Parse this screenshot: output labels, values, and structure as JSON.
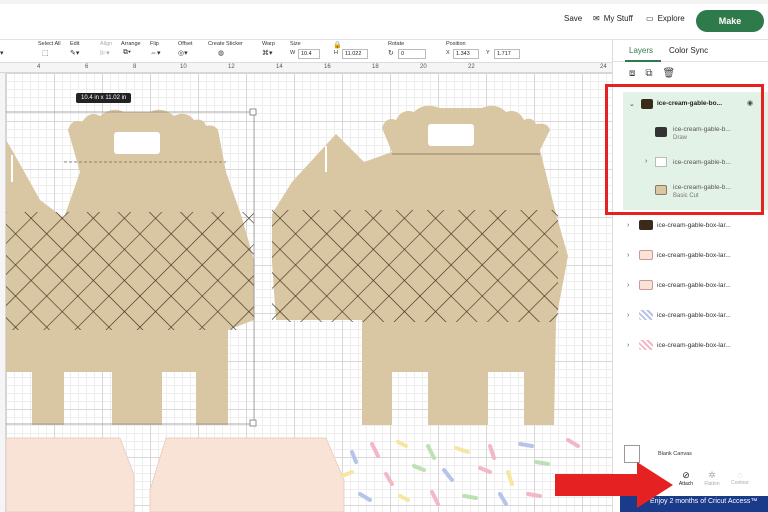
{
  "topbar": {
    "save": "Save",
    "my_stuff": "My Stuff",
    "explore": "Explore",
    "make": "Make"
  },
  "toolbar": {
    "select_all": "Select All",
    "edit": "Edit",
    "align": "Align",
    "arrange": "Arrange",
    "flip": "Flip",
    "offset": "Offset",
    "create_sticker": "Create Sticker",
    "warp": "Warp",
    "size": "Size",
    "w_label": "W",
    "w_value": "10.4",
    "h_label": "H",
    "h_value": "11.022",
    "rotate": "Rotate",
    "rotate_value": "0",
    "position": "Position",
    "x_label": "X",
    "x_value": "1.343",
    "y_label": "Y",
    "y_value": "1.717"
  },
  "ruler": {
    "marks": [
      "4",
      "6",
      "8",
      "10",
      "12",
      "14",
      "16",
      "18",
      "20",
      "22",
      "24"
    ]
  },
  "canvas": {
    "dimension_label": "10.4  in x 11.02  in"
  },
  "panel": {
    "tabs": [
      "Layers",
      "Color Sync"
    ],
    "selected_group": "ice-cream-gable-bo...",
    "sub_layers": [
      {
        "name": "ice-cream-gable-b...",
        "op": "Draw"
      },
      {
        "name": "ice-cream-gable-b...",
        "op": ""
      },
      {
        "name": "ice-cream-gable-b...",
        "op": "Basic Cut"
      }
    ],
    "layers": [
      "ice-cream-gable-box-lar...",
      "ice-cream-gable-box-lar...",
      "ice-cream-gable-box-lar...",
      "ice-cream-gable-box-lar...",
      "ice-cream-gable-box-lar..."
    ],
    "blank_canvas": "Blank Canvas",
    "actions": [
      "Attach",
      "Flatten",
      "Contour"
    ],
    "promo": "Enjoy 2 months of Cricut Access™"
  },
  "colors": {
    "accent": "#2f7a4a",
    "highlight": "#e52121",
    "kraft": "#d9c6a2",
    "pink": "#f9e2d6"
  }
}
